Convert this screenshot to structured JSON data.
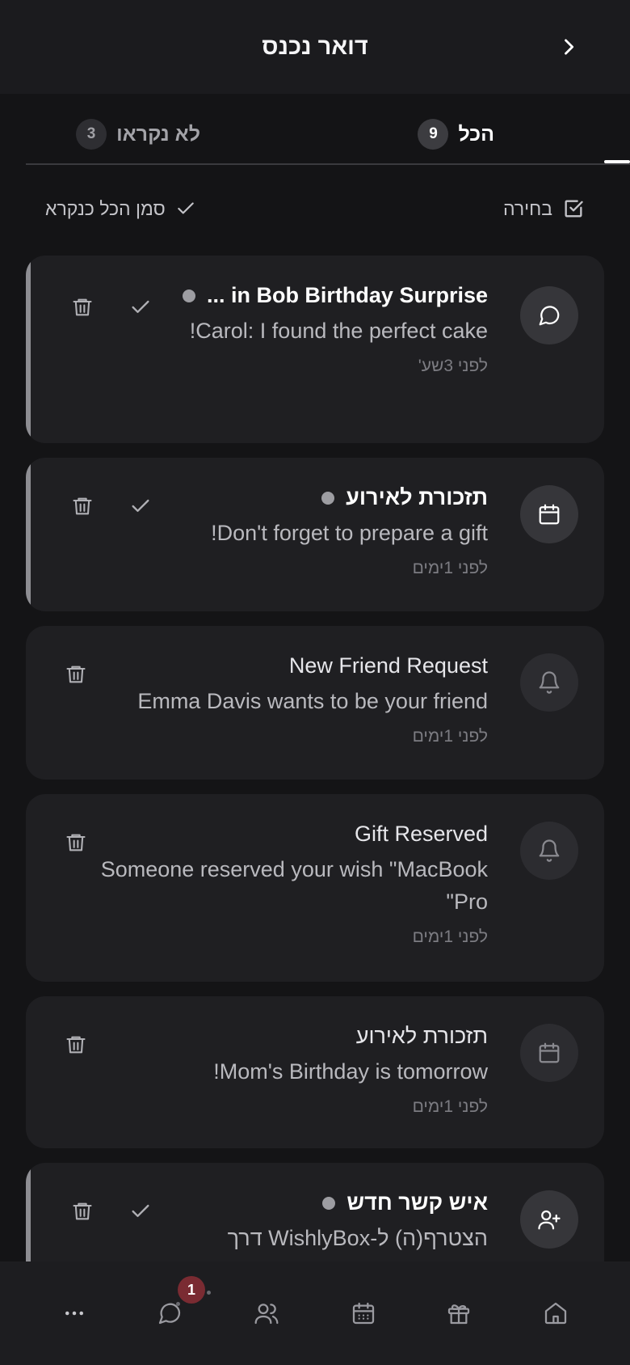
{
  "header": {
    "title": "דואר נכנס"
  },
  "tabs": [
    {
      "label": "הכל",
      "count": "9",
      "active": true
    },
    {
      "label": "לא נקראו",
      "count": "3",
      "active": false
    }
  ],
  "actions": {
    "select_label": "בחירה",
    "mark_all_label": "סמן הכל כנקרא"
  },
  "notifications": [
    {
      "icon": "chat-icon",
      "title": "in Bob Birthday Surprise ...",
      "message": "Carol: I found the perfect cake!",
      "time": "לפני 3שע'",
      "unread": true
    },
    {
      "icon": "calendar-icon",
      "title": "תזכורת לאירוע",
      "message": "Don't forget to prepare a gift!",
      "time": "לפני 1ימים",
      "unread": true
    },
    {
      "icon": "bell-icon",
      "title": "New Friend Request",
      "message": "Emma Davis wants to be your friend",
      "time": "לפני 1ימים",
      "unread": false
    },
    {
      "icon": "bell-icon",
      "title": "Gift Reserved",
      "message": "Someone reserved your wish \"MacBook Pro\"",
      "time": "לפני 1ימים",
      "unread": false
    },
    {
      "icon": "calendar-icon",
      "title": "תזכורת לאירוע",
      "message": "Mom's Birthday is tomorrow!",
      "time": "לפני 1ימים",
      "unread": false
    },
    {
      "icon": "user-plus-icon",
      "title": "איש קשר חדש",
      "message": "הצטרף(ה) ל-WishlyBox דרך",
      "time": "",
      "unread": true
    }
  ],
  "bottom_nav": {
    "items": [
      "more-icon",
      "chat-icon",
      "users-icon",
      "calendar-icon",
      "gift-icon",
      "home-icon"
    ],
    "chat_badge": "1"
  },
  "colors": {
    "background": "#141416",
    "card": "#1f1f22",
    "accent_bar": "#8e8e93",
    "badge": "#7a2b32"
  }
}
